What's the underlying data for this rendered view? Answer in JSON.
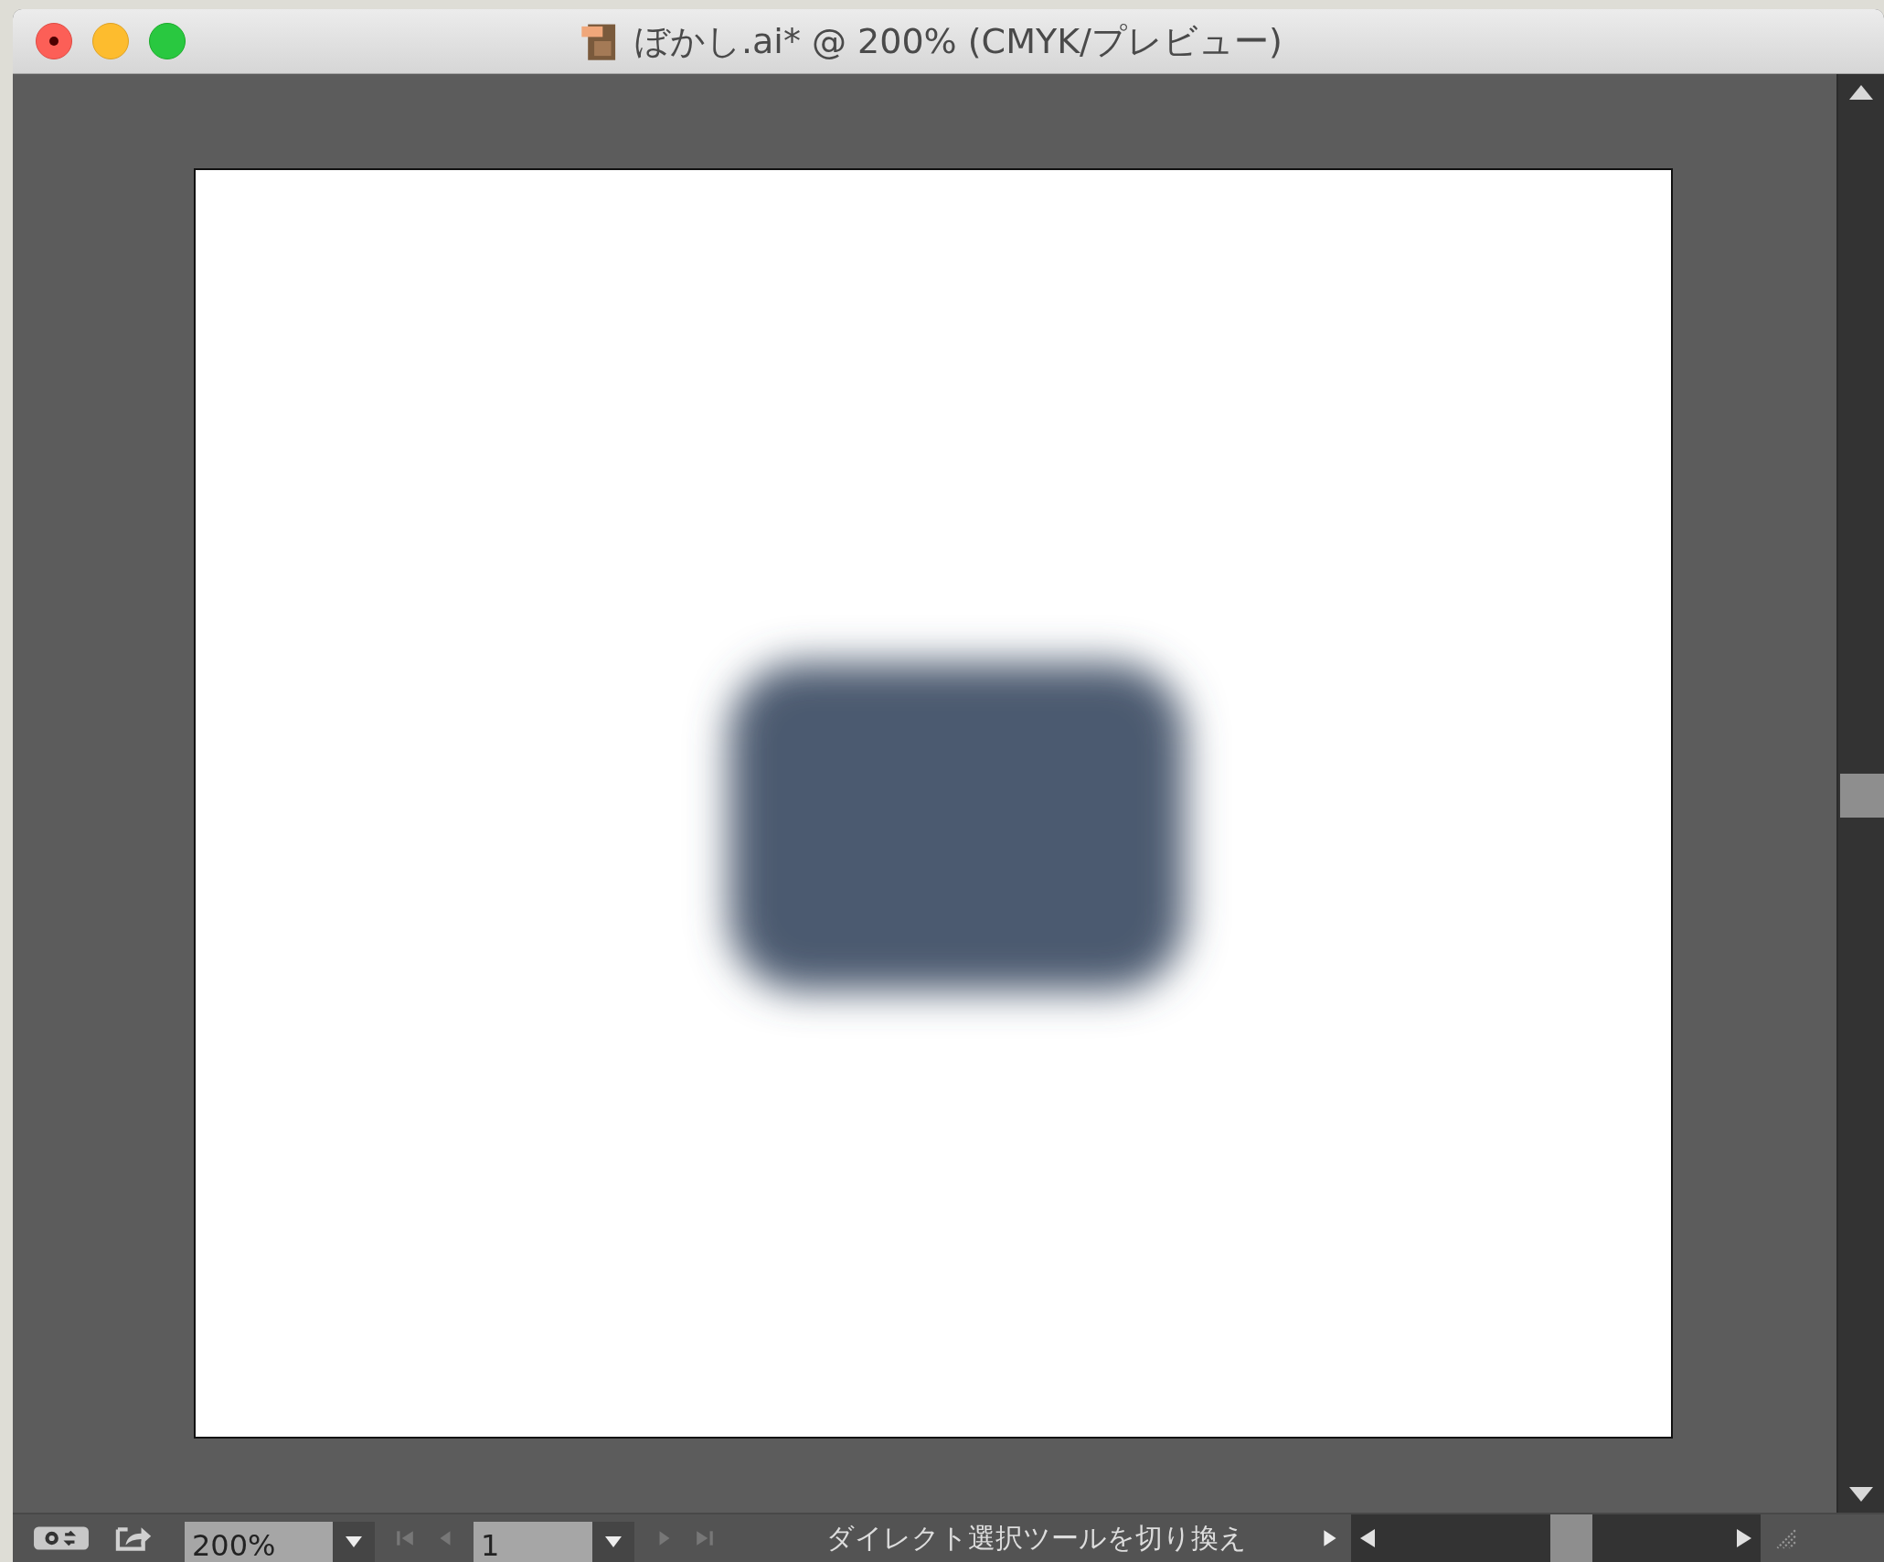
{
  "window": {
    "title": "ぼかし.ai* @ 200% (CMYK/プレビュー)"
  },
  "status_bar": {
    "zoom": {
      "value": "200%"
    },
    "page": {
      "value": "1"
    },
    "status_text": "ダイレクト選択ツールを切り換え"
  }
}
